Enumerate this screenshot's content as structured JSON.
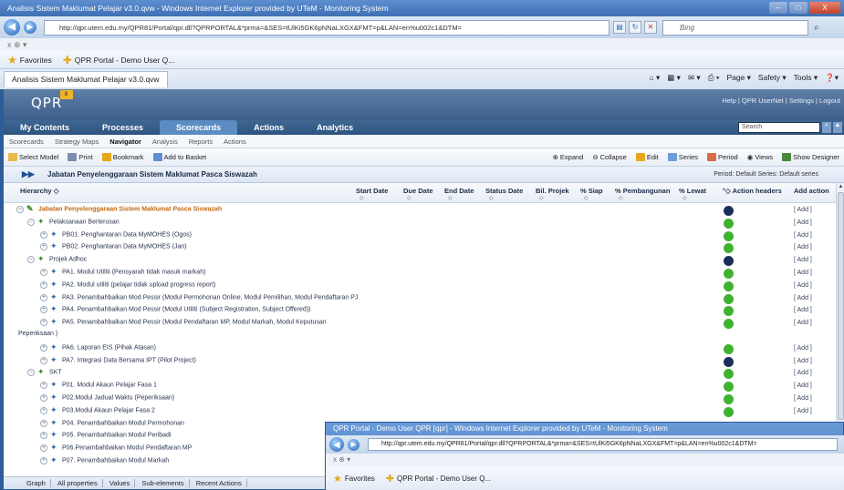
{
  "window": {
    "title": "Analisis Sistem Maklumat Pelajar v3.0.qvw - Windows Internet Explorer provided by UTeM - Monitoring System",
    "controls": {
      "minimize": "–",
      "maximize": "□",
      "close": "X"
    }
  },
  "address_bar": {
    "url": "http://qpr.utem.edu.my/QPR81/Portal/qpr.dll?QPRPORTAL&*prma=&SES=tUlKi5GK6pNNaLXGX&FMT=p&LAN=en%u002c1&DTM=",
    "search_placeholder": "Bing"
  },
  "command_bar": {
    "text": "x  ⊕ ▾"
  },
  "favorites_bar": {
    "favorites_label": "Favorites",
    "link": "QPR Portal - Demo User Q..."
  },
  "tab": {
    "label": "Analisis Sistem Maklumat Pelajar v3.0.qvw"
  },
  "ie_tools": {
    "page": "Page ▾",
    "safety": "Safety ▾",
    "tools": "Tools ▾",
    "help": "❓▾"
  },
  "qpr": {
    "logo_text": "QPR",
    "logo_badge": "8",
    "top_links": "Help  |  QPR UserNet  |  Settings  |  Logout",
    "search_placeholder": "Search",
    "main_nav": [
      "My Contents",
      "Processes",
      "Scorecards",
      "Actions",
      "Analytics"
    ],
    "active_nav": "Scorecards",
    "sub_nav": [
      "Scorecards",
      "Strategy Maps",
      "Navigator",
      "Analysis",
      "Reports",
      "Actions"
    ],
    "active_sub": "Navigator",
    "toolbar_left": [
      "Select Model",
      "Print",
      "Bookmark",
      "Add to Basket"
    ],
    "toolbar_right": [
      "Expand",
      "Collapse",
      "Edit",
      "Series",
      "Period",
      "Views",
      "Show Designer"
    ],
    "breadcrumb_title": "Jabatan Penyelenggaraan Sistem Maklumat Pasca Siswazah",
    "period_text": "Period: Default   Series: Default series"
  },
  "grid": {
    "headers": {
      "hierarchy": "Hierarchy",
      "start_date": "Start Date",
      "due_date": "Due Date",
      "end_date": "End Date",
      "status_date": "Status Date",
      "bil_projek": "Bil. Projek",
      "siap": "% Siap",
      "pembangunan": "% Pembangunan",
      "lewat": "% Lewat",
      "action_headers": "Action headers",
      "add_action": "Add action"
    },
    "rows": [
      {
        "text": "Jabatan Penyelenggaraan Sistem Maklumat Pasca Siswazah",
        "level": 0,
        "status": "navy",
        "add": "[ Add ]"
      },
      {
        "text": "Pelaksanaan Berterusan",
        "level": 1,
        "status": "green",
        "add": "[ Add ]"
      },
      {
        "text": "PB01. Penghantaran Data MyMOHES (Ogos)",
        "level": 2,
        "status": "green",
        "add": "[ Add ]"
      },
      {
        "text": "PB02. Penghantaran Data MyMOHES (Jan)",
        "level": 2,
        "status": "green",
        "add": "[ Add ]"
      },
      {
        "text": "Projek Adhoc",
        "level": 1,
        "status": "navy",
        "add": "[ Add ]"
      },
      {
        "text": "PA1. Modul Utiliti (Pensyarah tidak masuk markah)",
        "level": 2,
        "status": "green",
        "add": "[ Add ]"
      },
      {
        "text": "PA2. Modul utiliti (pelajar tidak upload progress report)",
        "level": 2,
        "status": "green",
        "add": "[ Add ]"
      },
      {
        "text": "PA3. Penambahbaikan Mod Pessir (Modul Permohonan Online, Modul Pemilihan, Modul Pendaftaran PJ",
        "level": 2,
        "status": "green",
        "add": "[ Add ]"
      },
      {
        "text": "PA4. Penambahbaikan Mod Pessir (Modul Utiliti (Subject Registration, Subject Offered))",
        "level": 2,
        "status": "green",
        "add": "[ Add ]"
      },
      {
        "text": "PA5. Penambahbaikan Mod Pessir (Modul Pendaftaran MP, Modul Markah, Modul Keputusan",
        "level": 2,
        "status": "green",
        "add": "[ Add ]"
      },
      {
        "text": "Peperiksaan )",
        "level": -1,
        "status": "",
        "add": ""
      },
      {
        "text": "PA6. Laporan EIS (Pihak Atasan)",
        "level": 2,
        "status": "green",
        "add": "[ Add ]"
      },
      {
        "text": "PA7. Integrasi Data Bersama IPT (Pilot Project)",
        "level": 2,
        "status": "navy",
        "add": "[ Add ]"
      },
      {
        "text": "SKT",
        "level": 1,
        "status": "green",
        "add": "[ Add ]"
      },
      {
        "text": "P01. Modul Akaun Pelajar Fasa 1",
        "level": 2,
        "status": "green",
        "add": "[ Add ]"
      },
      {
        "text": "P02.Modul Jadual Waktu (Peperiksaan)",
        "level": 2,
        "status": "green",
        "add": "[ Add ]"
      },
      {
        "text": "P03.Modul Akaun Pelajar Fasa 2",
        "level": 2,
        "status": "green",
        "add": "[ Add ]"
      },
      {
        "text": "P04. Penambahbaikan Modul Permohonan",
        "level": 2,
        "status": "",
        "add": ""
      },
      {
        "text": "P05. Penambahbaikan Modul Peribadi",
        "level": 2,
        "status": "",
        "add": ""
      },
      {
        "text": "P06.Penambahbaikan Modul Pendaftaran MP",
        "level": 2,
        "status": "",
        "add": ""
      },
      {
        "text": "P07. Penambahbaikan Modul Markah",
        "level": 2,
        "status": "",
        "add": ""
      }
    ]
  },
  "footer_tabs": [
    "Graph",
    "All properties",
    "Values",
    "Sub-elements",
    "Recent Actions"
  ],
  "popup": {
    "title": "QPR Portal - Demo User QPR [qpr] - Windows Internet Explorer provided by UTeM - Monitoring System",
    "url": "http://qpr.utem.edu.my/QPR81/Portal/qpr.dll?QPRPORTAL&*prma=&SES=tUlKi5GK6pNNaLXGX&FMT=p&LAN=en%u002c1&DTM=",
    "cmd": "x  ⊕ ▾",
    "favorites_label": "Favorites",
    "link": "QPR Portal - Demo User Q..."
  },
  "colors": {
    "status_green": "#3fb22f",
    "status_navy": "#1c2f5c",
    "accent_orange": "#c46a12"
  }
}
